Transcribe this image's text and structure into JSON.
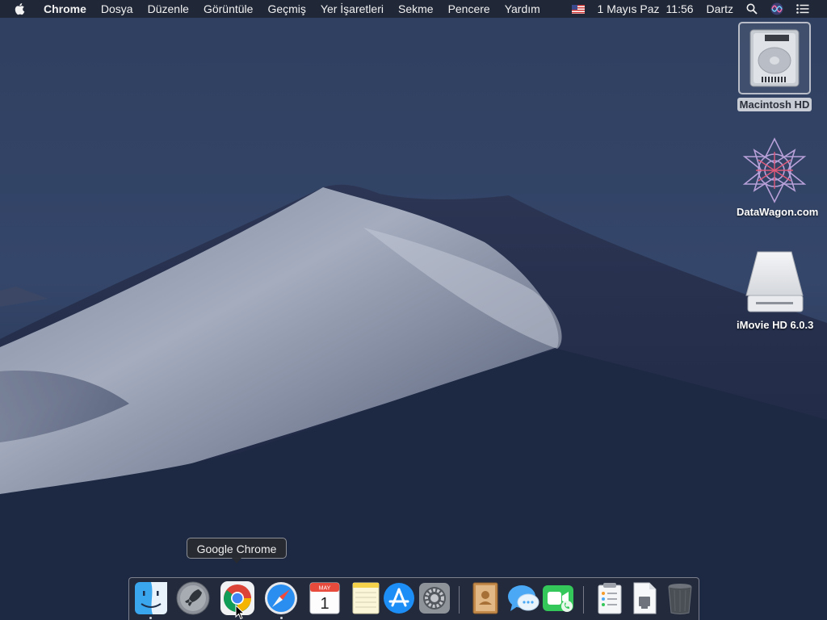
{
  "menubar": {
    "app_name": "Chrome",
    "menus": [
      "Dosya",
      "Düzenle",
      "Görüntüle",
      "Geçmiş",
      "Yer İşaretleri",
      "Sekme",
      "Pencere",
      "Yardım"
    ],
    "date": "1 Mayıs Paz",
    "time": "11:56",
    "user": "Dartz"
  },
  "desktop": {
    "icons": [
      {
        "label": "Macintosh HD",
        "icon": "hard-drive-icon",
        "selected": true
      },
      {
        "label": "DataWagon.com",
        "icon": "datawagon-logo-icon",
        "selected": false
      },
      {
        "label": "iMovie HD 6.0.3",
        "icon": "disk-image-icon",
        "selected": false
      }
    ]
  },
  "tooltip": {
    "text": "Google Chrome"
  },
  "dock": {
    "calendar_month": "MAY",
    "calendar_day": "1",
    "apps": [
      "finder-icon",
      "launchpad-icon",
      "chrome-icon",
      "safari-icon",
      "calendar-icon",
      "notes-icon",
      "app-store-icon",
      "system-preferences-icon",
      "contacts-icon",
      "messages-icon",
      "facetime-icon",
      "preview-icon",
      "file-icon",
      "trash-icon"
    ]
  },
  "colors": {
    "wallpaper_sky": "#2b3a5c",
    "dune_light": "#9aa3b8",
    "menubar": "#1c202c"
  }
}
